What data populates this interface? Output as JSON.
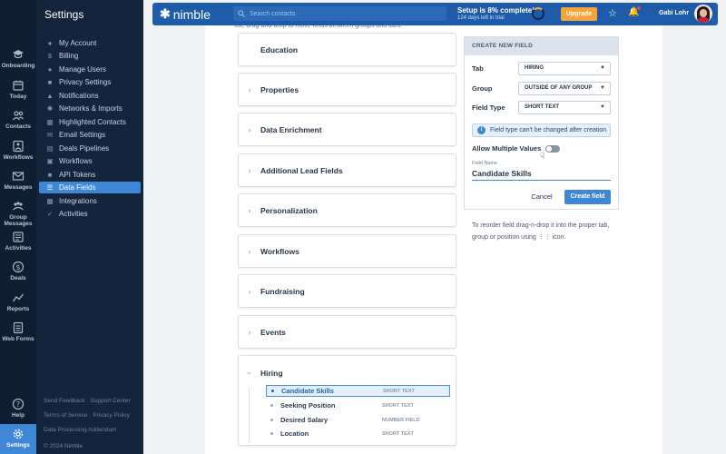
{
  "rail": {
    "items": [
      {
        "label": "Onboarding",
        "icon": "graduation-cap-icon"
      },
      {
        "label": "Today",
        "icon": "calendar-icon"
      },
      {
        "label": "Contacts",
        "icon": "people-icon"
      },
      {
        "label": "Workflows",
        "icon": "workflow-icon"
      },
      {
        "label": "Messages",
        "icon": "envelope-icon"
      },
      {
        "label": "Group Messages",
        "icon": "group-message-icon"
      },
      {
        "label": "Activities",
        "icon": "activities-icon"
      },
      {
        "label": "Deals",
        "icon": "dollar-icon"
      },
      {
        "label": "Reports",
        "icon": "chart-line-icon"
      },
      {
        "label": "Web Forms",
        "icon": "form-icon"
      },
      {
        "label": "Help",
        "icon": "help-icon"
      },
      {
        "label": "Settings",
        "icon": "gear-icon"
      }
    ]
  },
  "sidebar": {
    "title": "Settings",
    "items": [
      {
        "label": "My Account",
        "icon": "user-icon"
      },
      {
        "label": "Billing",
        "icon": "dollar-icon"
      },
      {
        "label": "Manage Users",
        "icon": "users-icon"
      },
      {
        "label": "Privacy Settings",
        "icon": "lock-icon"
      },
      {
        "label": "Notifications",
        "icon": "bell-icon"
      },
      {
        "label": "Networks & Imports",
        "icon": "network-icon"
      },
      {
        "label": "Highlighted Contacts",
        "icon": "highlight-icon"
      },
      {
        "label": "Email Settings",
        "icon": "email-icon"
      },
      {
        "label": "Deals Pipelines",
        "icon": "pipeline-icon"
      },
      {
        "label": "Workflows",
        "icon": "workflow-icon"
      },
      {
        "label": "API Tokens",
        "icon": "key-icon"
      },
      {
        "label": "Data Fields",
        "icon": "list-icon",
        "active": true
      },
      {
        "label": "Integrations",
        "icon": "puzzle-icon"
      },
      {
        "label": "Activities",
        "icon": "check-icon"
      }
    ],
    "footer": {
      "send_feedback": "Send Feedback",
      "support_center": "Support Center",
      "terms": "Terms of Service",
      "privacy": "Privacy Policy",
      "dpa": "Data Processing Addendum",
      "copyright": "© 2024 Nimble"
    }
  },
  "topbar": {
    "brand": "nimble",
    "search_placeholder": "Search contacts",
    "setup_title": "Setup is 8% complete!",
    "setup_sub": "124 days left in trial",
    "setup_progress": 0.08,
    "upgrade_label": "Upgrade",
    "user_name": "Gabi Lohr",
    "accent": "#1e5caa",
    "upgrade_color": "#f6a33a"
  },
  "main": {
    "intro": "use drag-and-drop to move fields between groups and tabs.",
    "groups": [
      {
        "name": "Education"
      },
      {
        "name": "Properties"
      },
      {
        "name": "Data Enrichment"
      },
      {
        "name": "Additional Lead Fields"
      },
      {
        "name": "Personalization"
      },
      {
        "name": "Workflows"
      },
      {
        "name": "Fundraising"
      },
      {
        "name": "Events"
      }
    ],
    "hiring": {
      "name": "Hiring",
      "fields": [
        {
          "name": "Candidate Skills",
          "type": "SHORT TEXT",
          "selected": true
        },
        {
          "name": "Seeking Position",
          "type": "SHORT TEXT"
        },
        {
          "name": "Desired Salary",
          "type": "NUMBER FIELD"
        },
        {
          "name": "Location",
          "type": "SHORT TEXT"
        }
      ]
    }
  },
  "create_field": {
    "header": "CREATE NEW FIELD",
    "tab_label": "Tab",
    "tab_value": "HIRING",
    "group_label": "Group",
    "group_value": "OUTSIDE OF ANY GROUP",
    "field_type_label": "Field Type",
    "field_type_value": "SHORT TEXT",
    "info_text": "Field type can't be changed after creation",
    "multi_label": "Allow Multiple Values",
    "multi_value": false,
    "field_name_label": "Field Name",
    "field_name_value": "Candidate Skills",
    "cancel_label": "Cancel",
    "create_label": "Create field"
  },
  "hint": {
    "before": "To reorder field drag-n-drop it into the proper tab, group or position using",
    "after": "icon."
  }
}
